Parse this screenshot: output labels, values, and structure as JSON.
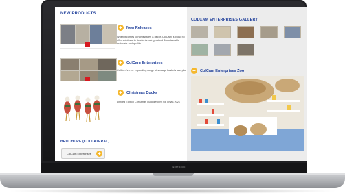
{
  "laptop": {
    "brand": "NoteBook"
  },
  "left": {
    "heading": "NEW PRODUCTS",
    "products": [
      {
        "title": "New Releases",
        "description": "When it comes to homewares & decor, ColCam is proud to offer solutions to its clients using natural & sustainable materials and quality"
      },
      {
        "title": "ColCam Enterprises",
        "description": "ColCam's ever expanding range of storage baskets and planters"
      },
      {
        "title": "Christmas Ducks",
        "description": "Limited Edition Christmas duck designs for Xmas 2021"
      }
    ],
    "brochure_heading": "BROCHURE (COLLATERAL)",
    "brochure_button": "ColCam Enterprises"
  },
  "right": {
    "gallery_heading": "COLCAM ENTERPRISES GALLERY",
    "zoo_title": "ColCam Enterprises Zoo"
  },
  "colors": {
    "accent": "#1f3f9a",
    "plus": "#f5b82e",
    "badge": "#d71920"
  }
}
